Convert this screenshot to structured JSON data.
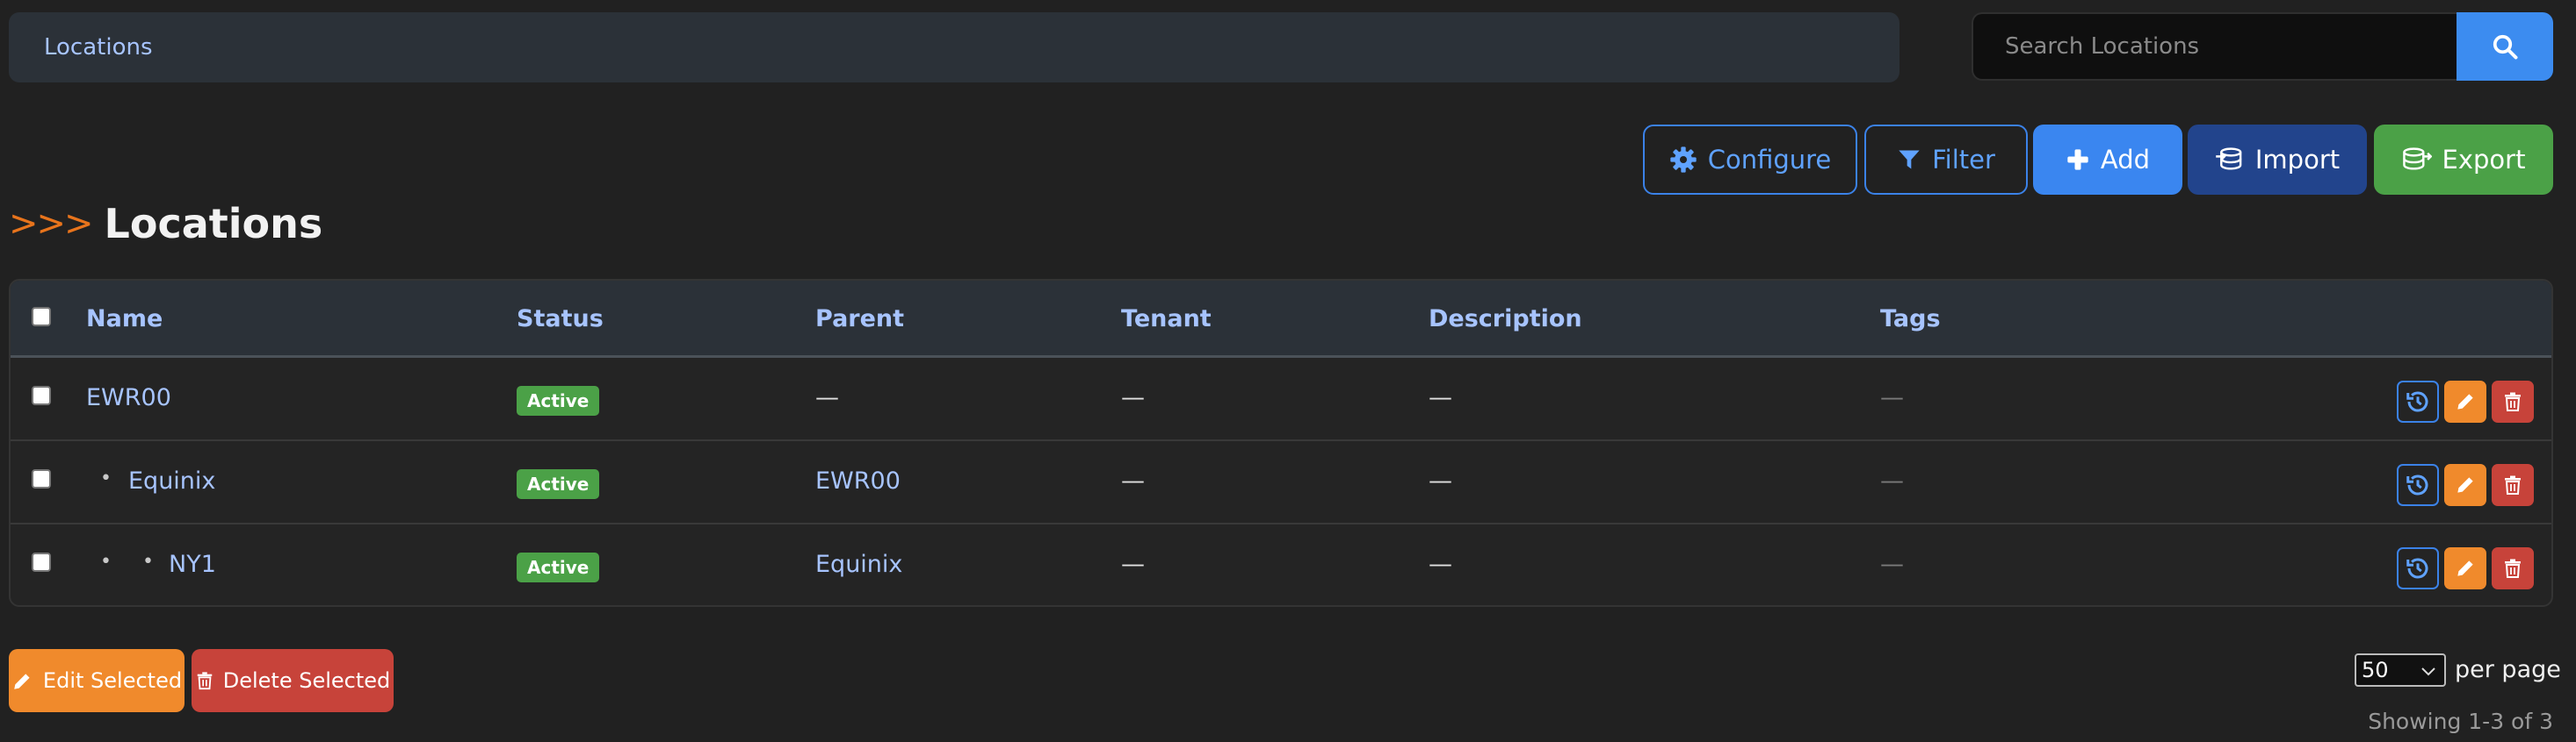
{
  "breadcrumb": {
    "label": "Locations"
  },
  "search": {
    "placeholder": "Search Locations"
  },
  "toolbar": {
    "configure_label": "Configure",
    "filter_label": "Filter",
    "add_label": "Add",
    "import_label": "Import",
    "export_label": "Export"
  },
  "heading": {
    "prefix": ">>>",
    "title": "Locations"
  },
  "table": {
    "columns": [
      "Name",
      "Status",
      "Parent",
      "Tenant",
      "Description",
      "Tags"
    ],
    "rows": [
      {
        "name": "EWR00",
        "status": "Active",
        "parent": "—",
        "tenant": "—",
        "description": "—",
        "tags": "—"
      },
      {
        "name": "Equinix",
        "status": "Active",
        "parent": "EWR00",
        "tenant": "—",
        "description": "—",
        "tags": "—"
      },
      {
        "name": "NY1",
        "status": "Active",
        "parent": "Equinix",
        "tenant": "—",
        "description": "—",
        "tags": "—"
      }
    ],
    "tree_bullet": "•"
  },
  "bulk": {
    "edit_label": "Edit Selected",
    "delete_label": "Delete Selected"
  },
  "pagination": {
    "per_page_value": "50",
    "per_page_label": "per page",
    "showing": "Showing 1-3 of 3"
  },
  "colors": {
    "accent_blue": "#3a86f0",
    "status_active": "#4ba147",
    "edit_orange": "#f08a2c",
    "delete_red": "#c7433a",
    "arrows_orange": "#e8741c"
  },
  "icons": [
    "search-icon",
    "gear-icon",
    "filter-icon",
    "plus-icon",
    "database-import-icon",
    "database-export-icon",
    "history-icon",
    "pencil-icon",
    "trash-icon",
    "chevron-down-icon"
  ]
}
